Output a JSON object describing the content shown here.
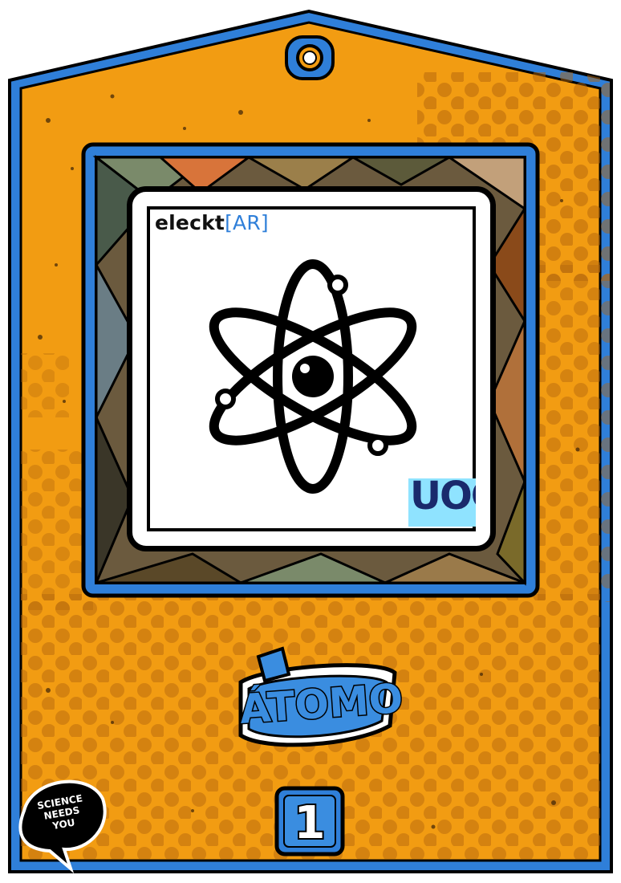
{
  "card": {
    "title": "ÁTOMO",
    "number": "1",
    "brand": {
      "prefix": "eleckt",
      "bracket_open": "[",
      "core": "AR",
      "bracket_close": "]"
    },
    "logo_text": "UOC",
    "badge_lines": [
      "SCIENCE",
      "NEEDS",
      "YOU"
    ]
  },
  "icons": {
    "main": "atom-icon",
    "hanger": "hanger-hole-icon"
  },
  "colors": {
    "card_orange": "#f29c12",
    "border_blue": "#2f7fd9",
    "outline": "#000000",
    "title_blue": "#3a8de0",
    "uoc_cyan": "#8fe3ff",
    "uoc_navy": "#1a2a6c",
    "brand_blue": "#2f7fd9"
  }
}
